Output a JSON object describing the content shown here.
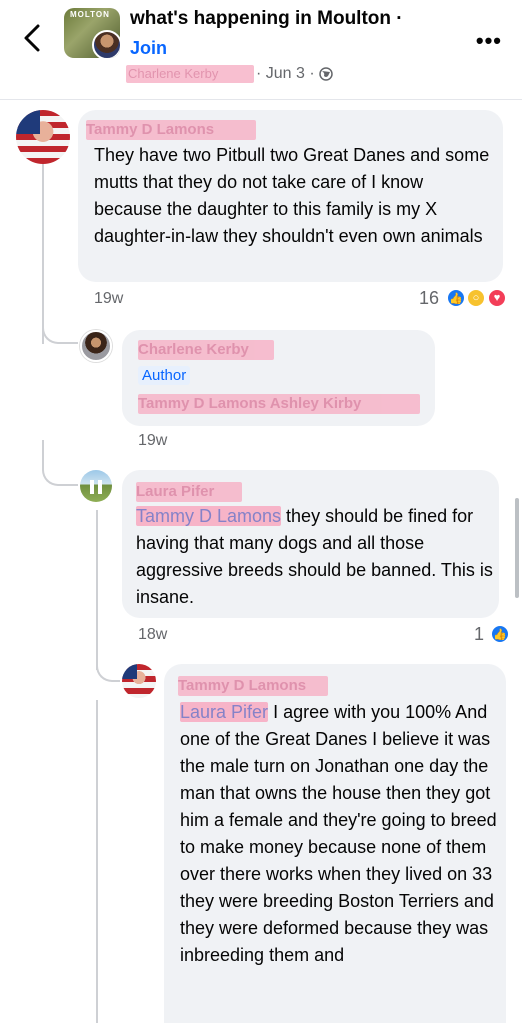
{
  "header": {
    "group_name": "what's happening  in Moulton ·",
    "group_avatar_text": "MOLTON",
    "join_label": "Join",
    "author_redacted": "Charlene Kerby",
    "date": "· Jun 3 ·",
    "more_label": "•••"
  },
  "comments": [
    {
      "author": "Tammy D Lamons",
      "text": "They have two Pitbull two Great Danes and some mutts that they do not take care of I know because the daughter to this family is my X daughter-in-law they shouldn't even own animals",
      "time": "19w",
      "reaction_count": "16",
      "reactions": [
        "like",
        "wow",
        "love"
      ]
    },
    {
      "author": "Charlene Kerby",
      "badge": "Author",
      "text_redacted": "Tammy D Lamons Ashley Kirby",
      "time": "19w"
    },
    {
      "author": "Laura Pifer",
      "mention": "Tammy D Lamons",
      "text": " they should be fined for having that many dogs and all those aggressive breeds should be banned. This is insane.",
      "time": "18w",
      "reaction_count": "1",
      "reactions": [
        "like"
      ]
    },
    {
      "author": "Tammy D Lamons",
      "mention": "Laura Pifer",
      "text": " I agree with you 100% And one of the Great Danes I believe it was the male turn on Jonathan one day the man that owns the house then they got him a female and they're going to breed to make money because none of them over there works when they lived on 33 they were breeding Boston Terriers and they were deformed because they was inbreeding them and"
    }
  ]
}
